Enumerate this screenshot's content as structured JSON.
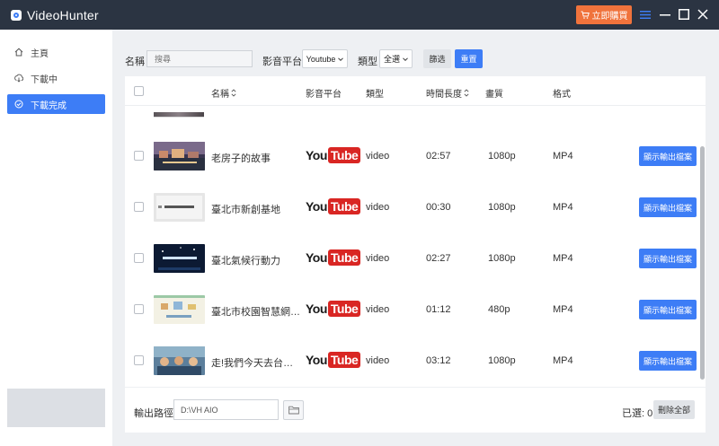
{
  "app": {
    "title": "VideoHunter",
    "buy_label": "立即購買"
  },
  "sidebar": {
    "items": [
      {
        "label": "主頁",
        "icon": "home-icon"
      },
      {
        "label": "下載中",
        "icon": "download-icon"
      },
      {
        "label": "下載完成",
        "icon": "check-circle-icon",
        "active": true
      }
    ]
  },
  "filters": {
    "name_label": "名稱",
    "search_placeholder": "搜尋",
    "platform_label": "影音平台",
    "platform_value": "Youtube",
    "type_label": "類型",
    "type_value": "全選",
    "filter_button": "篩选",
    "reset_button": "重置"
  },
  "table": {
    "headers": {
      "name": "名稱",
      "platform": "影音平台",
      "type": "類型",
      "duration": "時間長度",
      "quality": "畫質",
      "format": "格式"
    },
    "rows": [
      {
        "title": "老房子的故事",
        "platform": "YouTube",
        "type": "video",
        "duration": "02:57",
        "quality": "1080p",
        "format": "MP4",
        "action": "顯示輸出檔案"
      },
      {
        "title": "臺北市新創基地",
        "platform": "YouTube",
        "type": "video",
        "duration": "00:30",
        "quality": "1080p",
        "format": "MP4",
        "action": "顯示輸出檔案"
      },
      {
        "title": "臺北氣候行動力",
        "platform": "YouTube",
        "type": "video",
        "duration": "02:27",
        "quality": "1080p",
        "format": "MP4",
        "action": "顯示輸出檔案"
      },
      {
        "title": "臺北市校園智慧網絡...",
        "platform": "YouTube",
        "type": "video",
        "duration": "01:12",
        "quality": "480p",
        "format": "MP4",
        "action": "顯示輸出檔案"
      },
      {
        "title": "走!我們今天去台北...",
        "platform": "YouTube",
        "type": "video",
        "duration": "03:12",
        "quality": "1080p",
        "format": "MP4",
        "action": "顯示輸出檔案"
      }
    ]
  },
  "footer": {
    "output_label": "輸出路徑",
    "output_path": "D:\\VH AIO",
    "selected_text": "已選: 0",
    "delete_all": "刪除全部"
  },
  "colors": {
    "titlebar": "#2b3442",
    "accent": "#3d7df6",
    "buy": "#f0733c",
    "youtube_red": "#d92623"
  }
}
